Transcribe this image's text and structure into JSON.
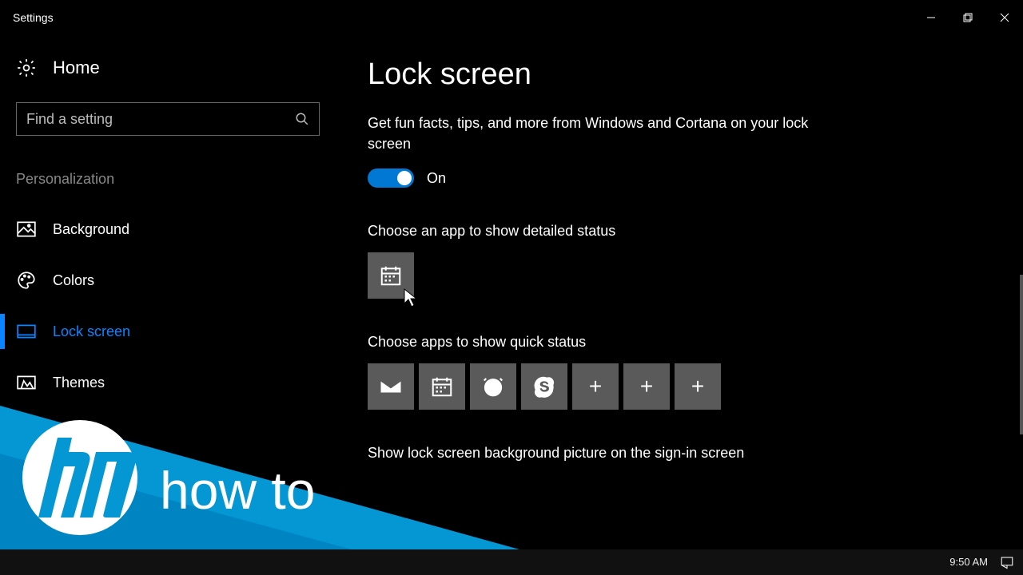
{
  "window": {
    "title": "Settings"
  },
  "sidebar": {
    "home": "Home",
    "search_placeholder": "Find a setting",
    "category": "Personalization",
    "items": [
      {
        "label": "Background"
      },
      {
        "label": "Colors"
      },
      {
        "label": "Lock screen"
      },
      {
        "label": "Themes"
      }
    ]
  },
  "main": {
    "title": "Lock screen",
    "tips_desc": "Get fun facts, tips, and more from Windows and Cortana on your lock screen",
    "tips_toggle_state": "On",
    "detailed_label": "Choose an app to show detailed status",
    "quick_label": "Choose apps to show quick status",
    "signin_label": "Show lock screen background picture on the sign-in screen",
    "quick_slots": [
      "mail",
      "calendar",
      "alarm",
      "skype",
      "add",
      "add",
      "add"
    ]
  },
  "overlay": {
    "brand_text": "how to"
  },
  "taskbar": {
    "time": "9:50 AM"
  }
}
